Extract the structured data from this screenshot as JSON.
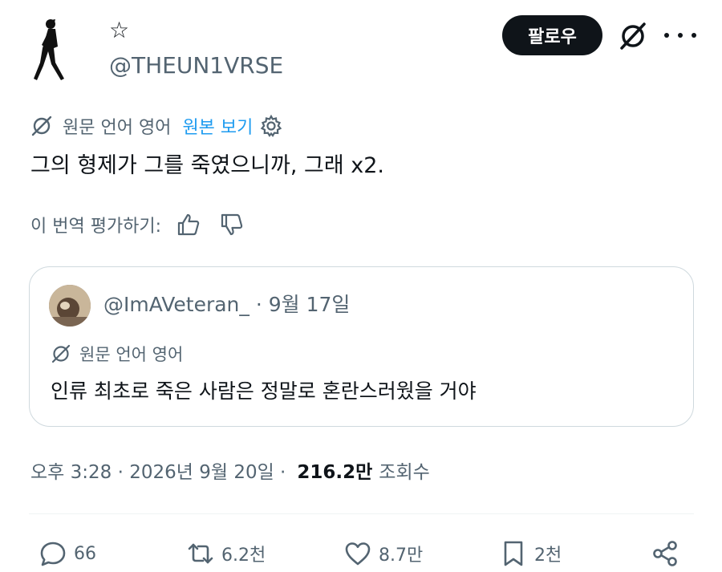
{
  "author": {
    "name": "☆",
    "handle": "@THEUN1VRSE"
  },
  "header": {
    "follow_label": "팔로우"
  },
  "translation": {
    "source_label": "원문 언어 영어",
    "view_original_label": "원본 보기"
  },
  "tweet": {
    "text": "그의 형제가 그를 죽였으니까, 그래 x2."
  },
  "rating": {
    "label": "이 번역 평가하기:"
  },
  "quote": {
    "handle_and_date": "@ImAVeteran_ · 9월 17일",
    "source_label": "원문 언어 영어",
    "text": "인류 최초로 죽은 사람은 정말로 혼란스러웠을 거야"
  },
  "meta": {
    "time_date": "오후 3:28 · 2026년 9월 20일 ·",
    "views_count": "216.2만",
    "views_label": "조회수"
  },
  "actions": {
    "reply_count": "66",
    "retweet_count": "6.2천",
    "like_count": "8.7만",
    "bookmark_count": "2천"
  },
  "colors": {
    "text": "#0f1419",
    "muted": "#536471",
    "link": "#1d9bf0",
    "border": "#cfd9de"
  },
  "icons": [
    "avatar",
    "grok-icon",
    "more-icon",
    "translate-icon",
    "gear-icon",
    "thumbs-up-icon",
    "thumbs-down-icon",
    "reply-icon",
    "retweet-icon",
    "heart-icon",
    "bookmark-icon",
    "share-icon"
  ]
}
